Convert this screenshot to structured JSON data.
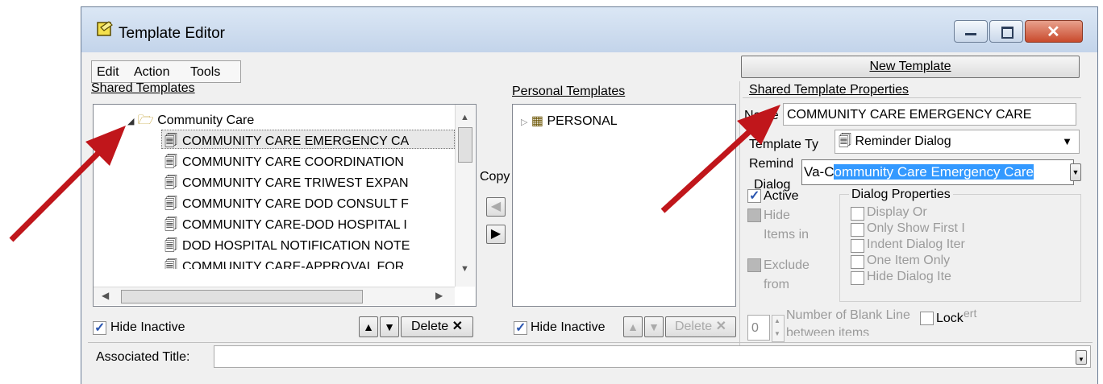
{
  "window": {
    "title": "Template Editor"
  },
  "menu": {
    "items": [
      "Edit",
      "Action",
      "Tools"
    ]
  },
  "new_template_button": "New Template",
  "shared_templates": {
    "label": "Shared Templates",
    "folder": "Community Care",
    "items": [
      "COMMUNITY CARE EMERGENCY CA",
      "COMMUNITY CARE COORDINATION",
      "COMMUNITY CARE TRIWEST EXPAN",
      "COMMUNITY CARE DOD CONSULT F",
      "COMMUNITY CARE-DOD HOSPITAL I",
      "DOD HOSPITAL NOTIFICATION NOTE",
      "COMMUNITY CARE-APPROVAL FOR"
    ],
    "hide_inactive": "Hide Inactive",
    "delete": "Delete"
  },
  "copy_label": "Copy",
  "personal_templates": {
    "label": "Personal Templates",
    "root": "PERSONAL",
    "hide_inactive": "Hide Inactive",
    "delete": "Delete"
  },
  "properties": {
    "label": "Shared Template Properties",
    "name_label": "Name",
    "name_value": "COMMUNITY CARE EMERGENCY CARE",
    "type_label": "Template Ty",
    "type_value": "Reminder Dialog",
    "reminder_label": "Remind",
    "dialog_label": "Dialog",
    "reminder_prefix": "Va-C",
    "reminder_selected": "ommunity Care Emergency Care",
    "active": "Active",
    "hide_items": [
      "Hide",
      "Items in"
    ],
    "exclude": [
      "Exclude",
      "from"
    ],
    "dialog_props_label": "Dialog Properties",
    "dialog_props": [
      "Display Or",
      "Only Show First I",
      "Indent Dialog Iter",
      "One Item Only",
      "Hide Dialog Ite"
    ],
    "blank_lines_value": "0",
    "blank_lines_label": "Number of Blank Line",
    "blank_lines_label2": "between items",
    "lock": "Lock",
    "insert_partial": "ert"
  },
  "associated_title_label": "Associated Title:",
  "colors": {
    "selection": "#3399ff",
    "arrow": "#c0161b",
    "title_gradient_top": "#dbe7f5"
  }
}
